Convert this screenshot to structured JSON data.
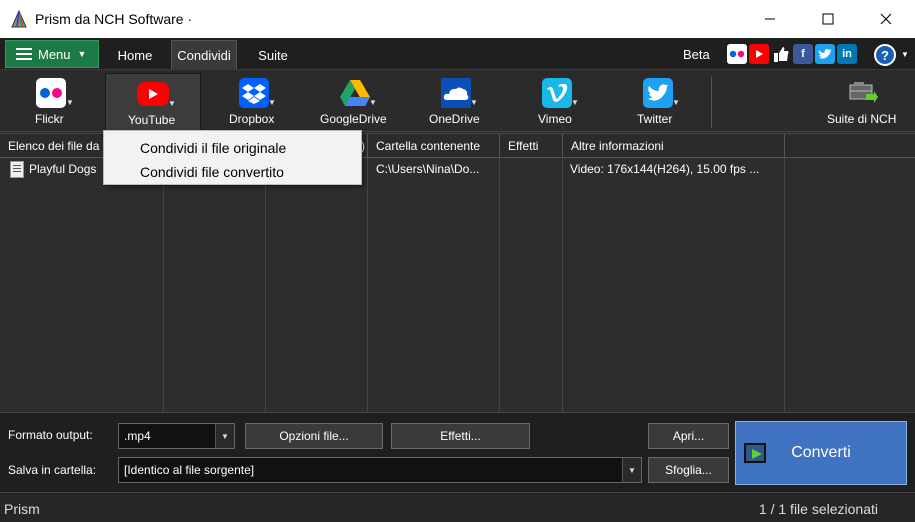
{
  "window": {
    "title": "Prism da NCH Software ·",
    "controls": [
      "minimize-icon",
      "maximize-icon",
      "close-icon"
    ]
  },
  "tabbar": {
    "menu_label": "Menu",
    "tabs": [
      {
        "label": "Home",
        "active": false
      },
      {
        "label": "Condividi",
        "active": true
      },
      {
        "label": "Suite",
        "active": false
      }
    ],
    "beta_label": "Beta",
    "social": [
      "flickr-icon",
      "youtube-icon",
      "like-icon",
      "facebook-icon",
      "twitter-icon",
      "linkedin-icon"
    ],
    "help_icon": "help-icon"
  },
  "toolbar": {
    "items": [
      {
        "label": "Flickr",
        "icon": "flickr-icon",
        "color": "#ffffff",
        "pressed": false
      },
      {
        "label": "YouTube",
        "icon": "youtube-icon",
        "color": "#ff0000",
        "pressed": true
      },
      {
        "label": "Dropbox",
        "icon": "dropbox-icon",
        "color": "#0061fe",
        "pressed": false
      },
      {
        "label": "GoogleDrive",
        "icon": "google-drive-icon",
        "color": "#1fa463",
        "pressed": false
      },
      {
        "label": "OneDrive",
        "icon": "onedrive-icon",
        "color": "#0a4fb5",
        "pressed": false
      },
      {
        "label": "Vimeo",
        "icon": "vimeo-icon",
        "color": "#1ab7ea",
        "pressed": false
      },
      {
        "label": "Twitter",
        "icon": "twitter-icon",
        "color": "#1da1f2",
        "pressed": false
      }
    ],
    "suite_label": "Suite di NCH"
  },
  "youtube_menu": {
    "items": [
      "Condividi il file originale",
      "Condividi file convertito"
    ]
  },
  "file_list": {
    "columns": [
      "Elenco dei file da",
      "",
      ")",
      "Cartella contenente",
      "Effetti",
      "Altre informazioni"
    ],
    "rows": [
      {
        "name": "Playful Dogs",
        "folder": "C:\\Users\\Nina\\Do...",
        "effects": "",
        "info": "Video: 176x144(H264), 15.00 fps ..."
      }
    ]
  },
  "bottom": {
    "output_format_label": "Formato output:",
    "output_format_value": ".mp4",
    "file_options_label": "Opzioni file...",
    "effects_label": "Effetti...",
    "open_label": "Apri...",
    "convert_label": "Converti",
    "save_in_label": "Salva in cartella:",
    "save_in_value": "[Identico al file sorgente]",
    "browse_label": "Sfoglia..."
  },
  "status": {
    "left": "Prism",
    "right": "1 / 1 file selezionati"
  }
}
